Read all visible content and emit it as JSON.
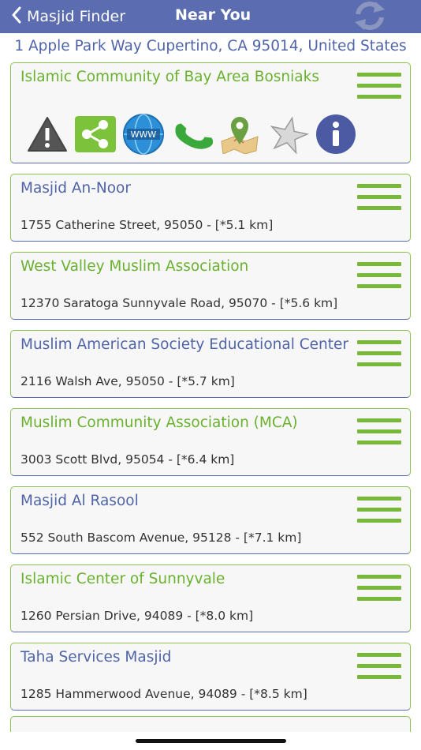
{
  "nav": {
    "back_label": "Masjid Finder",
    "title": "Near You"
  },
  "location": {
    "address": "1 Apple Park Way Cupertino, CA 95014, United States"
  },
  "selected": {
    "name": "Islamic Community of Bay Area Bosniaks",
    "actions": [
      "warning-icon",
      "share-icon",
      "website-icon",
      "phone-icon",
      "map-pin-icon",
      "favorite-star-icon",
      "info-icon"
    ]
  },
  "masjids": [
    {
      "name": "Masjid An-Noor",
      "address": "1755 Catherine Street, 95050 - [*5.1 km]",
      "color": "blue"
    },
    {
      "name": "West Valley Muslim Association",
      "address": "12370 Saratoga Sunnyvale Road, 95070 - [*5.6 km]",
      "color": "green"
    },
    {
      "name": "Muslim American Society Educational Center",
      "address": "2116 Walsh Ave, 95050 - [*5.7 km]",
      "color": "blue"
    },
    {
      "name": "Muslim Community Association (MCA)",
      "address": "3003 Scott Blvd, 95054 - [*6.4 km]",
      "color": "green"
    },
    {
      "name": "Masjid Al Rasool",
      "address": "552 South Bascom Avenue, 95128 - [*7.1 km]",
      "color": "blue"
    },
    {
      "name": "Islamic Center of Sunnyvale",
      "address": "1260 Persian Drive, 94089 - [*8.0 km]",
      "color": "green"
    },
    {
      "name": "Taha Services Masjid",
      "address": "1285 Hammerwood Avenue, 94089 - [*8.5 km]",
      "color": "blue"
    }
  ],
  "colors": {
    "navbar": "#5b6db0",
    "accent_green": "#69b12f",
    "accent_blue": "#5064a8"
  }
}
